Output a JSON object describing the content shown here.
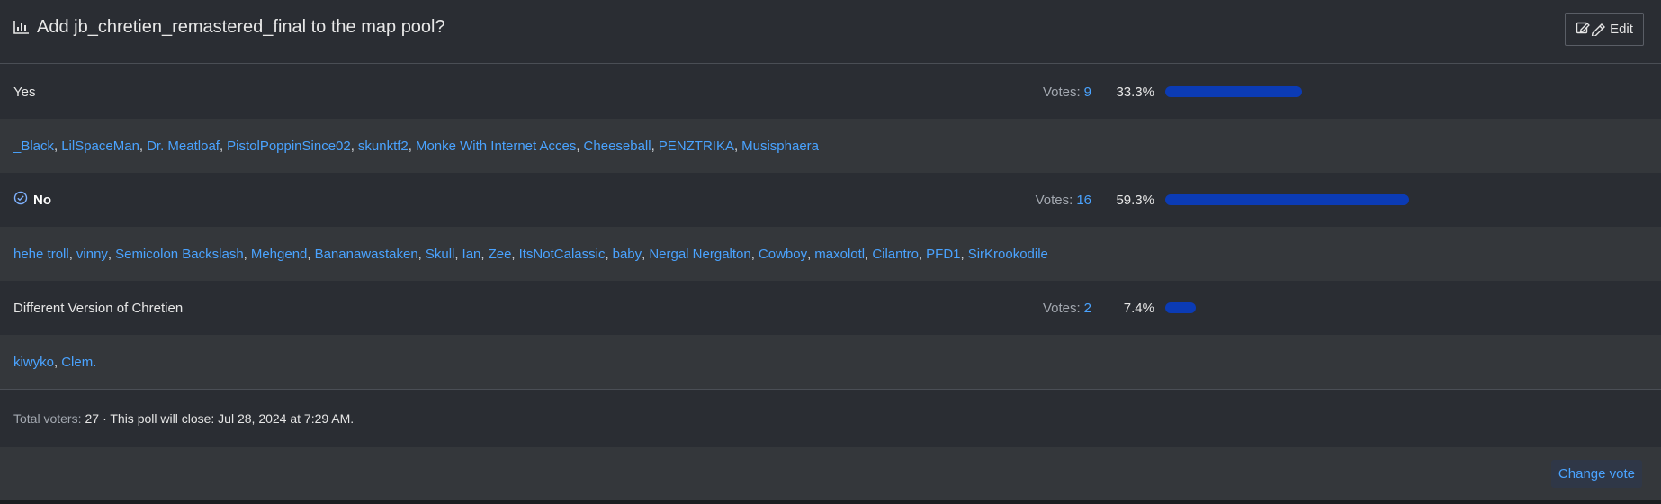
{
  "header": {
    "title": "Add jb_chretien_remastered_final to the map pool?",
    "title_icon": "bar-chart-icon",
    "edit_label": "Edit",
    "edit_icon": "edit-icon"
  },
  "votes_label": "Votes:",
  "options": [
    {
      "label": "Yes",
      "votes": "9",
      "percent": "33.3%",
      "fraction": 0.333,
      "chosen": false,
      "voters": [
        "_Black",
        "LilSpaceMan",
        "Dr. Meatloaf",
        "PistolPoppinSince02",
        "skunktf2",
        "Monke With Internet Acces",
        "Cheeseball",
        "PENZTRIKA",
        "Musisphaera"
      ]
    },
    {
      "label": "No",
      "votes": "16",
      "percent": "59.3%",
      "fraction": 0.593,
      "chosen": true,
      "voters": [
        "hehe troll",
        "vinny",
        "Semicolon Backslash",
        "Mehgend",
        "Bananawastaken",
        "Skull",
        "Ian",
        "Zee",
        "ItsNotCalassic",
        "baby",
        "Nergal Nergalton",
        "Cowboy",
        "maxolotl",
        "Cilantro",
        "PFD1",
        "SirKrookodile"
      ]
    },
    {
      "label": "Different Version of Chretien",
      "votes": "2",
      "percent": "7.4%",
      "fraction": 0.074,
      "chosen": false,
      "voters": [
        "kiwyko",
        "Clem."
      ]
    }
  ],
  "footer": {
    "total_voters_label": "Total voters:",
    "total_voters": "27",
    "close_text": "· This poll will close: Jul 28, 2024 at 7:29 AM."
  },
  "actions": {
    "change_vote_label": "Change vote"
  },
  "colors": {
    "bar": "#0b3bb5",
    "link": "#4aa3ff",
    "background": "#2a2d33",
    "alt_background": "#34373b"
  }
}
